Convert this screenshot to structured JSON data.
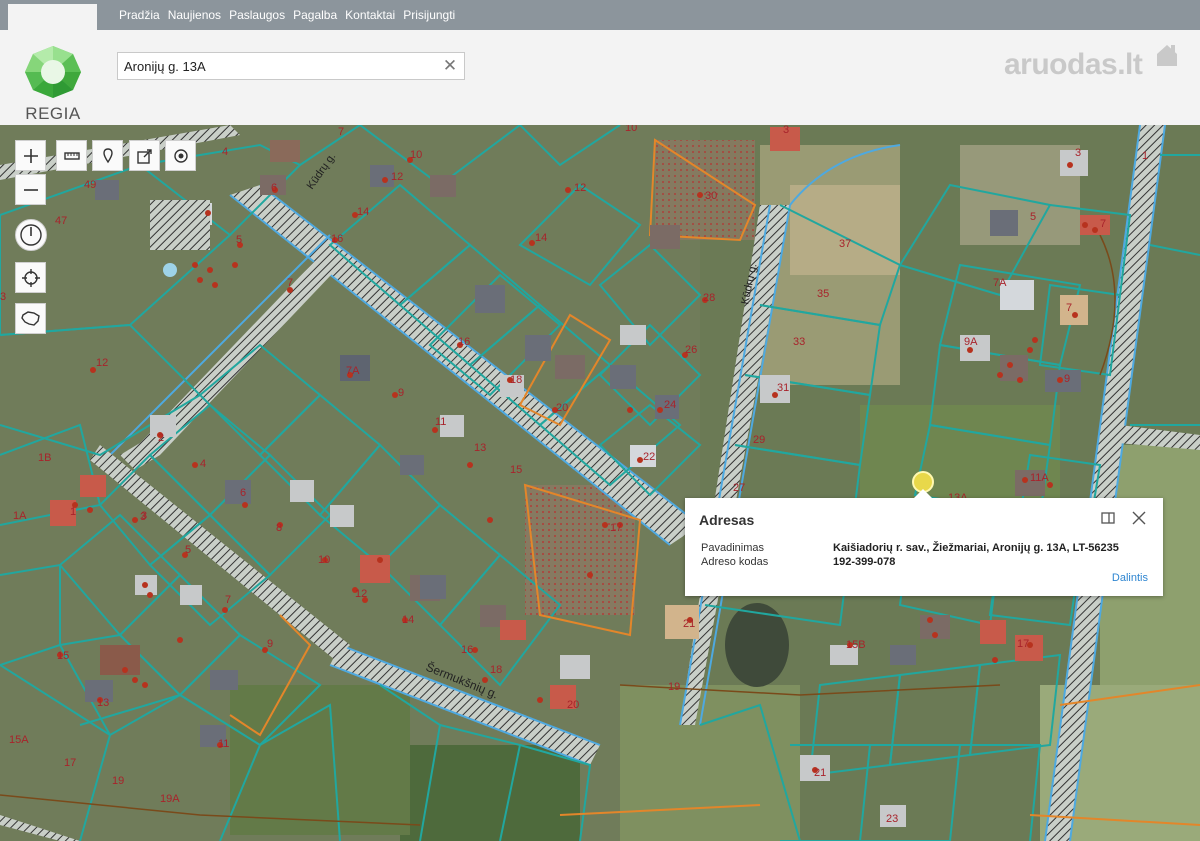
{
  "nav": {
    "items": [
      "Pradžia",
      "Naujienos",
      "Paslaugos",
      "Pagalba",
      "Kontaktai",
      "Prisijungti"
    ]
  },
  "logo": {
    "text": "REGIA"
  },
  "search": {
    "value": "Aronijų g. 13A"
  },
  "brand": {
    "text": "aruodas.lt"
  },
  "colors": {
    "nav_bg": "#8c959c",
    "header_bg": "#f3f3f3",
    "parcel_line": "#21a79f",
    "road_outline": "#4ea9e0",
    "link": "#2f86d1",
    "marker": "#e8d84a"
  },
  "toolbar": {
    "icons": [
      "zoom-in-icon",
      "zoom-out-icon",
      "measure-icon",
      "pin-icon",
      "export-icon",
      "target-icon",
      "compass-icon",
      "locate-icon",
      "lithuania-outline-icon"
    ]
  },
  "map": {
    "street_labels": [
      "Kūdrų g.",
      "Kūdrų g.",
      "Šermukšnių g."
    ],
    "parcel_numbers": [
      "49",
      "47",
      "4",
      "6",
      "5",
      "7",
      "10",
      "12",
      "14",
      "16",
      "3",
      "10",
      "12",
      "14",
      "16",
      "4",
      "18",
      "20",
      "22",
      "24",
      "26",
      "28",
      "30",
      "37",
      "35",
      "33",
      "31",
      "29",
      "27",
      "7A",
      "9",
      "11",
      "13",
      "15",
      "17",
      "21",
      "23",
      "1B",
      "1A",
      "1",
      "3",
      "5",
      "7",
      "9",
      "11",
      "13",
      "15",
      "15A",
      "17",
      "19",
      "19A",
      "10",
      "12",
      "14",
      "16",
      "18",
      "20",
      "3",
      "6",
      "8",
      "5",
      "7",
      "9",
      "9A",
      "7A",
      "11A",
      "13A",
      "15B",
      "17",
      "19",
      "21",
      "23"
    ]
  },
  "popup": {
    "title": "Adresas",
    "rows": [
      {
        "label": "Pavadinimas",
        "value": "Kaišiadorių r. sav., Žiežmariai, Aronijų g. 13A, LT-56235"
      },
      {
        "label": "Adreso kodas",
        "value": "192-399-078"
      }
    ],
    "link": "Dalintis"
  }
}
